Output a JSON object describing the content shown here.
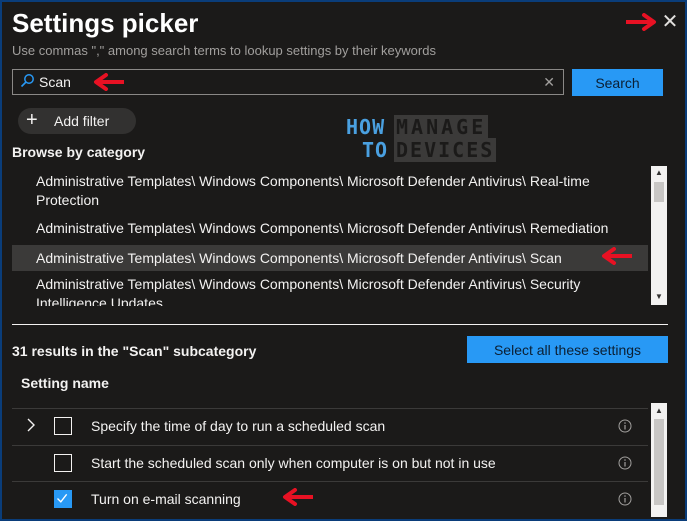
{
  "header": {
    "title": "Settings picker",
    "subtitle": "Use commas \",\" among search terms to lookup settings by their keywords",
    "close_glyph": "✕"
  },
  "search": {
    "value": "Scan",
    "placeholder": "",
    "clear_glyph": "✕",
    "button_label": "Search"
  },
  "filter": {
    "add_label": "Add filter",
    "plus_glyph": "+"
  },
  "logo": {
    "line1a": "HOW",
    "line1b": "MANAGE",
    "line2a": "TO",
    "line2b": "DEVICES"
  },
  "browse": {
    "label": "Browse by category",
    "items": [
      {
        "label": "Administrative Templates\\ Windows Components\\ Microsoft Defender Antivirus\\ Real-time Protection"
      },
      {
        "label": "Administrative Templates\\ Windows Components\\ Microsoft Defender Antivirus\\ Remediation"
      },
      {
        "label": "Administrative Templates\\ Windows Components\\ Microsoft Defender Antivirus\\ Scan"
      },
      {
        "label": "Administrative Templates\\ Windows Components\\ Microsoft Defender Antivirus\\ Security Intelligence Updates"
      }
    ],
    "selected_index": 2
  },
  "results": {
    "summary": "31 results in the \"Scan\" subcategory",
    "select_all_label": "Select all these settings",
    "column_header": "Setting name",
    "rows": [
      {
        "label": "Specify the time of day to run a scheduled scan",
        "checked": false,
        "expandable": true
      },
      {
        "label": "Start the scheduled scan only when computer is on but not in use",
        "checked": false,
        "expandable": false
      },
      {
        "label": "Turn on e-mail scanning",
        "checked": true,
        "expandable": false
      }
    ]
  },
  "colors": {
    "background": "#1b1a19",
    "accent": "#2899f5",
    "selected_row": "#3b3a39",
    "annotation_arrow": "#e81123"
  }
}
